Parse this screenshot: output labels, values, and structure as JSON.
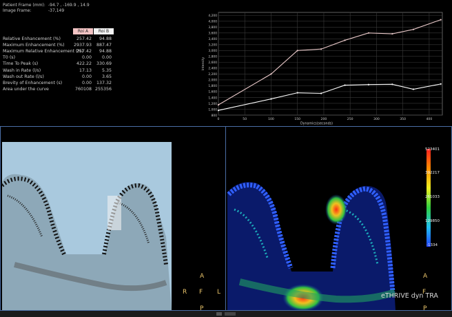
{
  "header": {
    "patient_frame_label": "Patient Frame  (mm):",
    "patient_frame_value": "-94.7 , -169.9 , 14.9",
    "image_frame_label": "Image Frame:",
    "image_frame_value": "-37,149"
  },
  "roi_table": {
    "col_a": "Roi A",
    "col_b": "Roi B",
    "rows": [
      {
        "label": "Relative Enhancement  (%)",
        "a": "257.42",
        "b": "94.88"
      },
      {
        "label": "Maximum Enhancement  (%)",
        "a": "2937.93",
        "b": "887.47"
      },
      {
        "label": "Maximum Relative Enhancement  (%)",
        "a": "257.42",
        "b": "94.88"
      },
      {
        "label": "T0  (s)",
        "a": "0.00",
        "b": "0.00"
      },
      {
        "label": "Time To Peak  (s)",
        "a": "422.22",
        "b": "330.69"
      },
      {
        "label": "Wash in Rate  (l/s)",
        "a": "17.13",
        "b": "5.35"
      },
      {
        "label": "Wash out Rate  (l/s)",
        "a": "0.00",
        "b": "3.65"
      },
      {
        "label": "Brevity of Enhancement  (s)",
        "a": "0.00",
        "b": "137.32"
      },
      {
        "label": "Area under the curve",
        "a": "760108",
        "b": "255356"
      }
    ]
  },
  "chart_data": {
    "type": "line",
    "xlabel": "Dynamics(seconds)",
    "ylabel": "Intensity",
    "xlim": [
      0,
      425
    ],
    "ylim": [
      800,
      4300
    ],
    "x_ticks": [
      "0",
      "50",
      "100",
      "150",
      "200",
      "250",
      "300",
      "350",
      "400"
    ],
    "y_ticks": [
      "800",
      "1,000",
      "1,200",
      "1,400",
      "1,600",
      "1,800",
      "2,000",
      "2,200",
      "2,400",
      "2,600",
      "2,800",
      "3,000",
      "3,200",
      "3,400",
      "3,600",
      "3,800",
      "4,000",
      "4,200"
    ],
    "series": [
      {
        "color": "#e8c8c8",
        "x": [
          0,
          100,
          150,
          195,
          240,
          285,
          330,
          370,
          422
        ],
        "y": [
          1150,
          2200,
          3000,
          3050,
          3350,
          3600,
          3570,
          3720,
          4050
        ]
      },
      {
        "color": "#ffffff",
        "x": [
          0,
          100,
          150,
          195,
          240,
          285,
          330,
          370,
          422
        ],
        "y": [
          960,
          1350,
          1560,
          1540,
          1820,
          1840,
          1850,
          1680,
          1860
        ]
      }
    ]
  },
  "left_panel": {
    "orient_top": "A",
    "orient_left": "R",
    "orient_right": "L",
    "orient_bottom": "P",
    "orient_center": "F"
  },
  "right_panel": {
    "orient_top": "A",
    "orient_bottom": "P",
    "orient_center": "F",
    "series_label": "eTHRIVE dyn TRA",
    "colorbar_labels": [
      "523401",
      "392217",
      "261033",
      "129850",
      "-1334"
    ]
  },
  "colors": {
    "roi_a_bg": "#f3c4c4",
    "panel_border": "#4b6ea6",
    "orient_color": "#e8c36a",
    "left_bg": "#a9c9de"
  }
}
